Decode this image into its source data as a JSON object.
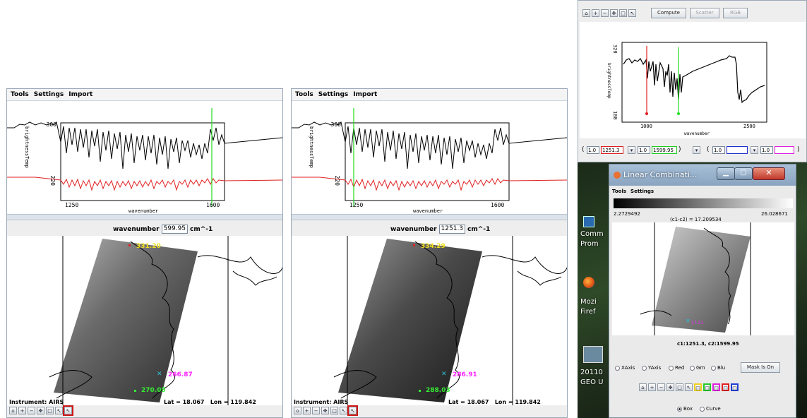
{
  "window1": {
    "menu": [
      "Tools",
      "Settings",
      "Import"
    ],
    "plot": {
      "y_axis_label": "brightnessTemp",
      "y_ticks": [
        "300",
        "220"
      ],
      "x_ticks": [
        "1250",
        "1600"
      ],
      "x_axis_label": "wavenumber"
    },
    "wavenumber_label": "wavenumber",
    "wavenumber_value": "599.95",
    "wavenumber_unit": "cm^-1",
    "probe_values": {
      "yellow": "331.20",
      "magenta": "266.87",
      "green": "270.05"
    },
    "instrument": "Instrument: AIRS",
    "latlon": "Lat = 18.067   Lon = 119.842"
  },
  "window2": {
    "menu": [
      "Tools",
      "Settings",
      "Import"
    ],
    "plot": {
      "y_axis_label": "brightnessTemp",
      "y_ticks": [
        "300",
        "220"
      ],
      "x_ticks": [
        "1250",
        "1600"
      ],
      "x_axis_label": "wavenumber"
    },
    "wavenumber_label": "wavenumber",
    "wavenumber_value": "1251.3",
    "wavenumber_unit": "cm^-1",
    "probe_values": {
      "yellow": "334.29",
      "magenta": "286.91",
      "green": "288.03"
    },
    "instrument": "Instrument: AIRS",
    "latlon": "Lat = 18.067   Lon = 119.842"
  },
  "window3": {
    "buttons": {
      "compute": "Compute",
      "scatter": "Scatter",
      "rgb": "RGB"
    },
    "plot": {
      "y_axis_label": "brightnessTemp",
      "y_ticks": [
        "320",
        "180"
      ],
      "x_ticks": [
        "1000",
        "2500"
      ],
      "x_axis_label": "wavenumber"
    },
    "coeff_red": "1.0",
    "field_red": "1251.3",
    "coeff_green": "1.0",
    "field_green": "1599.95",
    "coeff_blue": "1.0",
    "coeff_magenta": "1.0",
    "paren_open": "(",
    "paren_close": ")"
  },
  "window4": {
    "title": "Linear Combinati...",
    "menu": [
      "Tools",
      "Settings"
    ],
    "range_min": "2.2729492",
    "expression": "(c1-c2) = 17.209534",
    "range_max": "26.028671",
    "image_caption": "c1:1251.3, c2:1599.95",
    "probe": "17.21",
    "radios": [
      "XAxis",
      "YAxis",
      "Red",
      "Grn",
      "Blu"
    ],
    "mask_button": "Mask Is On",
    "mode_box": "Box",
    "mode_curve": "Curve"
  },
  "desktop": {
    "labels": [
      "Comm",
      "Prom",
      "Mozi",
      "Firef",
      "20110",
      "GEO U"
    ]
  },
  "colors": {
    "red_line": "#e02020",
    "green_line": "#22dd22",
    "yellow": "#f0e020",
    "magenta": "#ff22ff",
    "green_probe": "#33ee33",
    "cyan": "#30c0d0"
  }
}
